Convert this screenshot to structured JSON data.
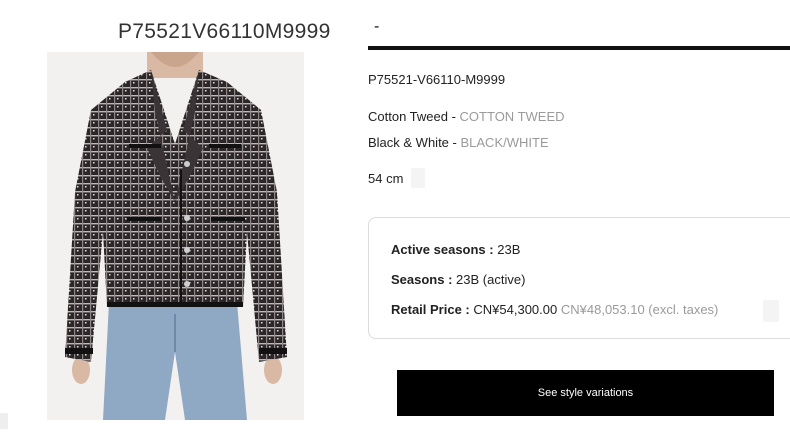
{
  "product": {
    "title_code": "P75521V66110M9999",
    "header_dash": "-",
    "reference": "P75521-V66110-M9999",
    "material": {
      "label": "Cotton Tweed",
      "separator": " - ",
      "code": "COTTON TWEED"
    },
    "color": {
      "label": "Black & White",
      "separator": " - ",
      "code": "BLACK/WHITE"
    },
    "size": "54 cm"
  },
  "details": {
    "active_seasons": {
      "label": "Active seasons :",
      "value": "23B"
    },
    "seasons": {
      "label": "Seasons :",
      "value": "23B (active)"
    },
    "retail_price": {
      "label": "Retail Price :",
      "value": "CN¥54,300.00",
      "excl_taxes": "CN¥48,053.10 (excl. taxes)"
    }
  },
  "actions": {
    "style_variations": "See style variations"
  },
  "image": {
    "icon": "product-photo-icon",
    "subject": "tweed jacket",
    "background_color": "#f3f1ef"
  }
}
